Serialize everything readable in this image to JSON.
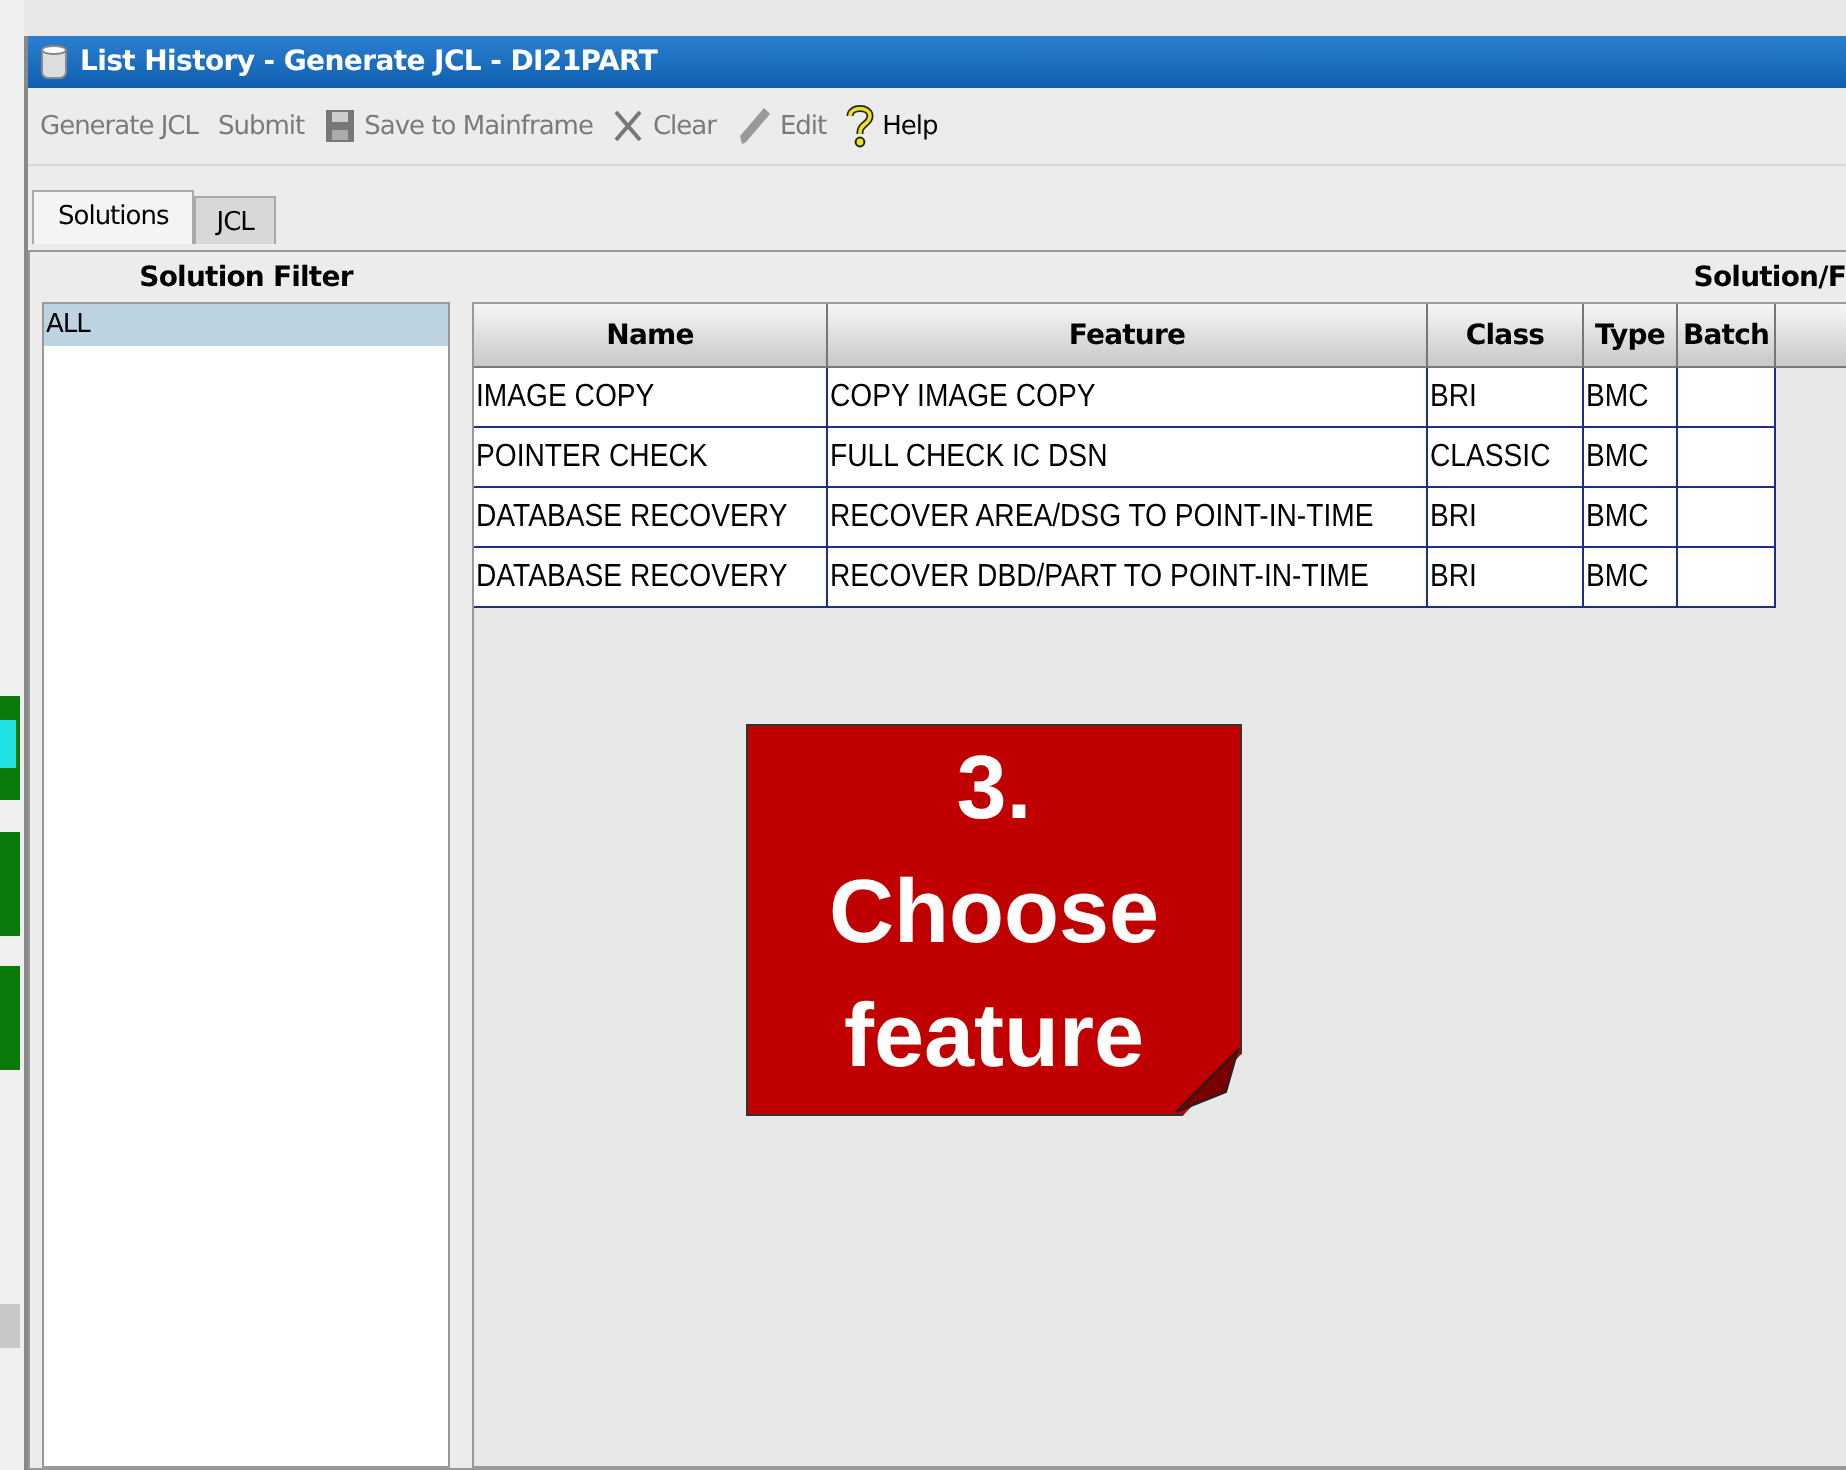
{
  "window": {
    "title": "List History - Generate JCL - DI21PART"
  },
  "toolbar": [
    {
      "label": "Generate JCL",
      "kind": "text",
      "disabled": true
    },
    {
      "label": "Submit",
      "kind": "text",
      "disabled": true
    },
    {
      "label": "Save to Mainframe",
      "kind": "save",
      "disabled": true
    },
    {
      "label": "Clear",
      "kind": "clear",
      "disabled": true
    },
    {
      "label": "Edit",
      "kind": "edit",
      "disabled": true
    },
    {
      "label": "Help",
      "kind": "help",
      "disabled": false
    }
  ],
  "tabs": [
    {
      "label": "Solutions",
      "selected": true
    },
    {
      "label": "JCL",
      "selected": false
    }
  ],
  "filter": {
    "title": "Solution Filter",
    "items": [
      {
        "label": "ALL",
        "selected": true
      }
    ]
  },
  "solutions": {
    "title": "Solution/F",
    "columns": [
      "Name",
      "Feature",
      "Class",
      "Type",
      "Batch"
    ],
    "rows": [
      {
        "cells": [
          "IMAGE COPY",
          "COPY IMAGE COPY",
          "BRI",
          "BMC",
          ""
        ]
      },
      {
        "cells": [
          "POINTER CHECK",
          "FULL CHECK IC DSN",
          "CLASSIC",
          "BMC",
          ""
        ]
      },
      {
        "cells": [
          "DATABASE RECOVERY",
          "RECOVER AREA/DSG TO POINT-IN-TIME",
          "BRI",
          "BMC",
          ""
        ]
      },
      {
        "cells": [
          "DATABASE RECOVERY",
          "RECOVER DBD/PART TO POINT-IN-TIME",
          "BRI",
          "BMC",
          ""
        ]
      }
    ]
  },
  "callout": {
    "lines": [
      "3.",
      "Choose",
      "feature"
    ]
  }
}
